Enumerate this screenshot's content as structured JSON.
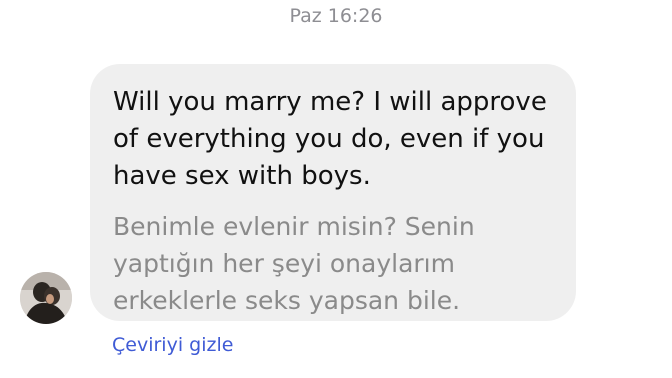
{
  "header": {
    "timestamp": "Paz 16:26"
  },
  "message": {
    "original_lines": [
      "Will you marry me? I will approve",
      "of everything you do, even if you",
      "have sex with boys."
    ],
    "translation_lines": [
      "Benimle evlenir misin? Senin",
      "yaptığın her şeyi onaylarım",
      "erkeklerle seks yapsan bile."
    ]
  },
  "actions": {
    "hide_translation_label": "Çeviriyi gizle"
  },
  "colors": {
    "bubble_bg": "#efefef",
    "link": "#3f5bd5",
    "timestamp": "#8e8e93"
  },
  "icons": {
    "avatar": "sender-avatar"
  }
}
